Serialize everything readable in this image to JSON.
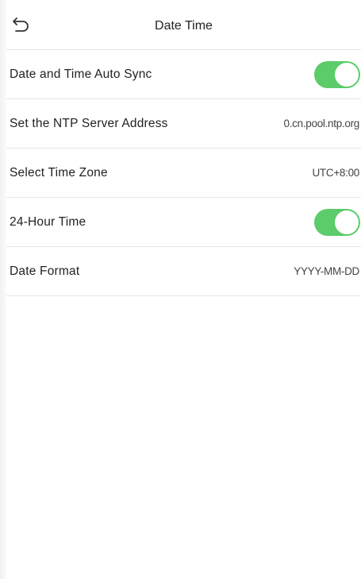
{
  "header": {
    "title": "Date Time",
    "back_icon": "back-arrow-icon"
  },
  "settings": [
    {
      "label": "Date and Time Auto Sync",
      "type": "toggle",
      "on": true
    },
    {
      "label": "Set the NTP Server Address",
      "type": "value",
      "value": "0.cn.pool.ntp.org"
    },
    {
      "label": "Select Time Zone",
      "type": "value",
      "value": "UTC+8:00"
    },
    {
      "label": "24-Hour Time",
      "type": "toggle",
      "on": true
    },
    {
      "label": "Date Format",
      "type": "value",
      "value": "YYYY-MM-DD"
    }
  ],
  "colors": {
    "toggle_on": "#5bcc69",
    "divider": "#e6e6e6",
    "background": "#ffffff"
  }
}
